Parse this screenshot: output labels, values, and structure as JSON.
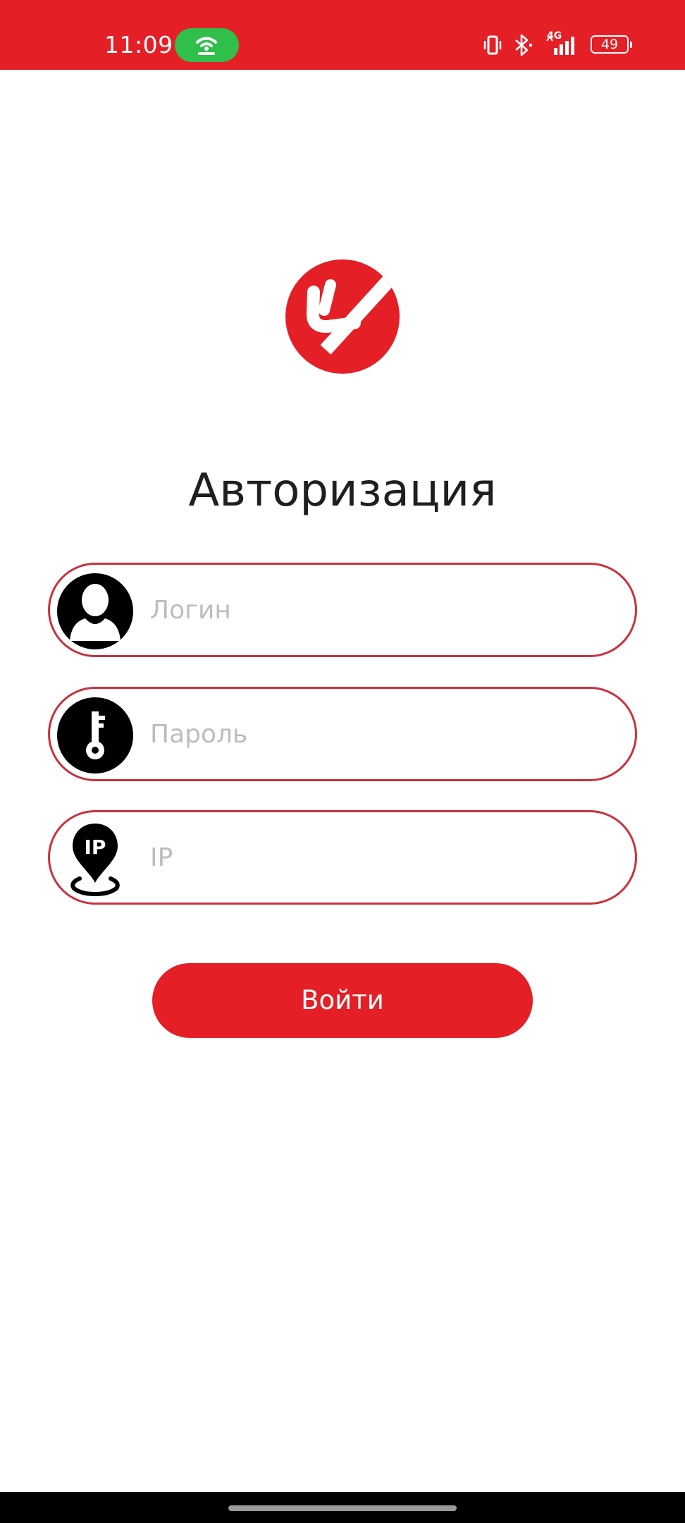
{
  "status_bar": {
    "time": "11:09",
    "battery": "49",
    "network": "4G",
    "icons": [
      "hotspot-icon",
      "vibrate-icon",
      "bluetooth-icon",
      "signal-icon",
      "battery-icon"
    ]
  },
  "colors": {
    "brand": "#e41f26",
    "field_border": "#c8323d",
    "hotspot": "#2fbf4a"
  },
  "logo": {
    "icon": "brand-logo"
  },
  "page": {
    "title": "Авторизация"
  },
  "form": {
    "login": {
      "placeholder": "Логин",
      "value": "",
      "icon": "user-icon"
    },
    "password": {
      "placeholder": "Пароль",
      "value": "",
      "icon": "key-icon"
    },
    "ip": {
      "placeholder": "IP",
      "value": "",
      "icon": "ip-location-icon",
      "icon_text": "IP"
    },
    "submit_label": "Войти"
  }
}
